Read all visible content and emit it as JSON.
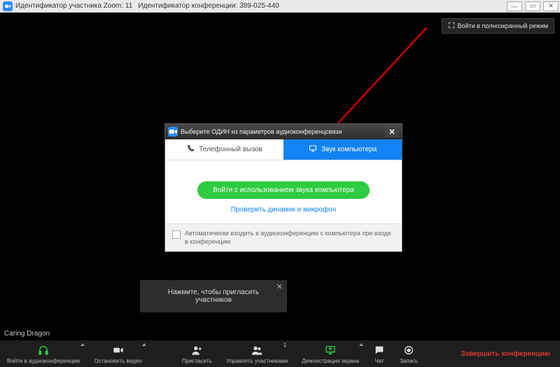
{
  "titlebar": {
    "participant_id_label": "Идентификатор участника Zoom: 11",
    "conference_id_label": "Идентификатор конференции: 389-025-440"
  },
  "fullscreen_btn": "Войти в полноэкранный режим",
  "dialog": {
    "title": "Выберите ОДИН из параметров аудиоконференцсвязи",
    "tab_phone": "Телефонный вызов",
    "tab_computer": "Звук компьютера",
    "join_button": "Войти с использованием звука компьютера",
    "test_link": "Проверить динамик и микрофон",
    "auto_join_label": "Автоматически входить в аудиоконференцию с компьютера при входе в конференцию"
  },
  "participant_name": "Caring Dragon",
  "invite_tooltip": "Нажмите, чтобы пригласить участников",
  "toolbar": {
    "audio": "Войти в аудиоконференцию",
    "video": "Остановить видео",
    "invite": "Пригласить",
    "participants": "Управлять участниками",
    "participants_count": "1",
    "share": "Демонстрация экрана",
    "chat": "Чат",
    "record": "Запись",
    "end": "Завершить конференцию"
  }
}
